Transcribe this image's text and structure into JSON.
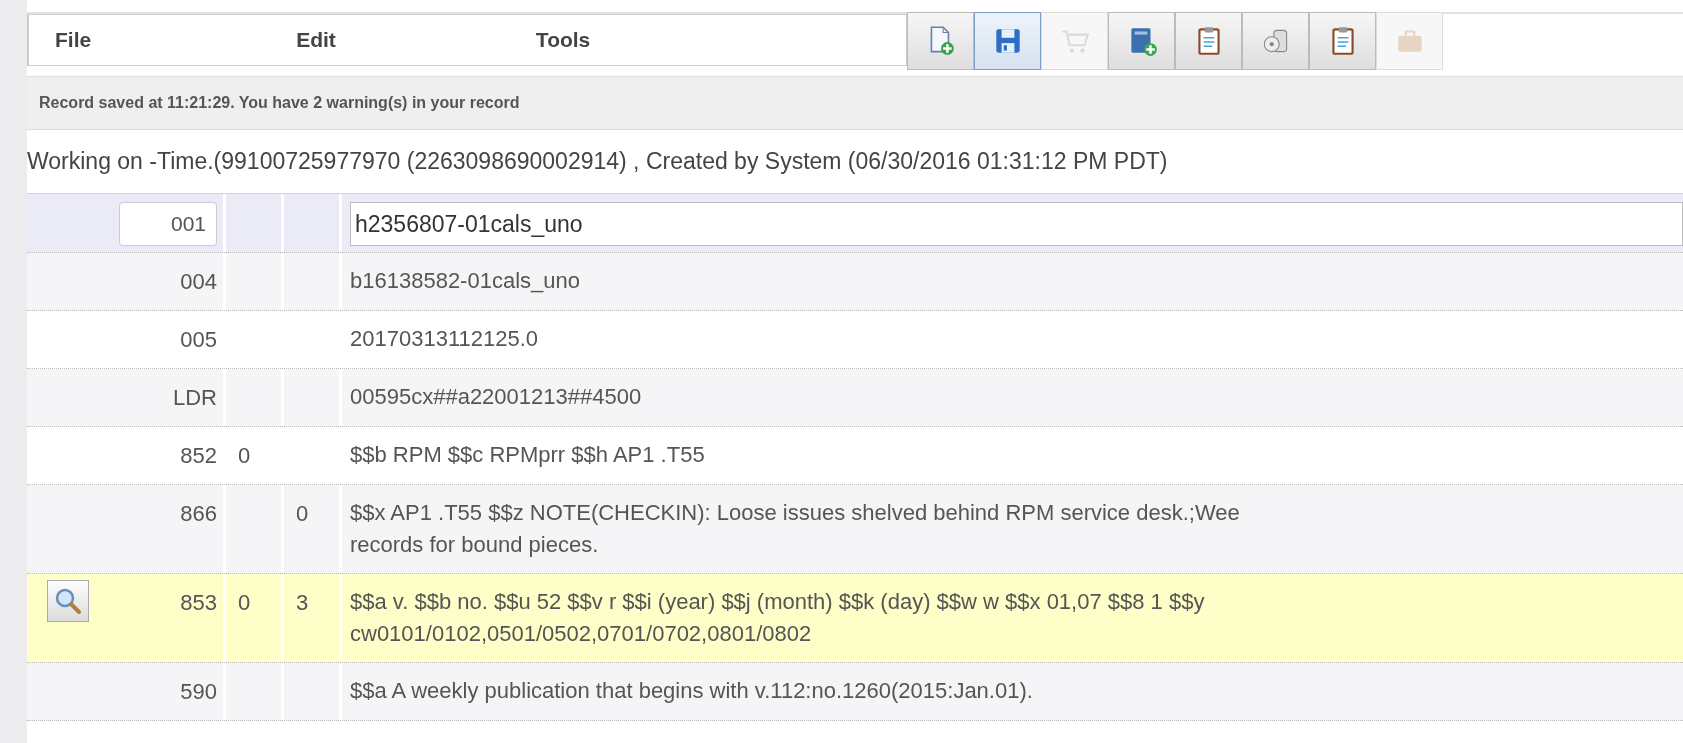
{
  "menu": [
    {
      "label": "File"
    },
    {
      "label": "Edit"
    },
    {
      "label": "Tools"
    }
  ],
  "toolbar": [
    {
      "kind": "new-document",
      "active": false,
      "disabled": false
    },
    {
      "kind": "save",
      "active": true,
      "disabled": false
    },
    {
      "kind": "cart",
      "active": false,
      "disabled": true
    },
    {
      "kind": "new-book",
      "active": false,
      "disabled": false
    },
    {
      "kind": "clipboard",
      "active": false,
      "disabled": false
    },
    {
      "kind": "disc",
      "active": false,
      "disabled": false
    },
    {
      "kind": "clipboard",
      "active": false,
      "disabled": false
    },
    {
      "kind": "briefcase",
      "active": false,
      "disabled": true
    }
  ],
  "status_message": "Record saved at 11:21:29. You have 2 warning(s) in your record",
  "working_on": "Working on -Time.(99100725977970 (2263098690002914) , Created by System (06/30/2016 01:31:12 PM PDT)",
  "fields": [
    {
      "tag": "001",
      "value": [
        "h2356807-01cals_uno"
      ],
      "selected": true,
      "warning": false
    },
    {
      "tag": "004",
      "value": [
        "b16138582-01cals_uno"
      ],
      "selected": false,
      "warning": false
    },
    {
      "tag": "005",
      "value": [
        "20170313112125.0"
      ],
      "selected": false,
      "warning": false
    },
    {
      "tag": "LDR",
      "value": [
        "00595cx##a22001213##4500"
      ],
      "selected": false,
      "warning": false
    },
    {
      "tag": "852",
      "ind1": "0",
      "value": [
        "$$b RPM $$c RPMprr $$h AP1 .T55"
      ],
      "selected": false,
      "warning": false
    },
    {
      "tag": "866",
      "ind2": "0",
      "value": [
        "$$x AP1 .T55 $$z NOTE(CHECKIN): Loose issues shelved behind RPM service desk.;Wee",
        "records for bound pieces."
      ],
      "selected": false,
      "warning": false
    },
    {
      "tag": "853",
      "ind1": "0",
      "ind2": "3",
      "value": [
        "$$a v. $$b no. $$u 52 $$v r $$i (year) $$j (month) $$k (day) $$w w $$x 01,07 $$8 1 $$y",
        "cw0101/0102,0501/0502,0701/0702,0801/0802"
      ],
      "selected": false,
      "warning": true
    },
    {
      "tag": "590",
      "value": [
        "$$a A weekly publication that begins with v.112:no.1260(2015:Jan.01)."
      ],
      "selected": false,
      "warning": false
    }
  ]
}
